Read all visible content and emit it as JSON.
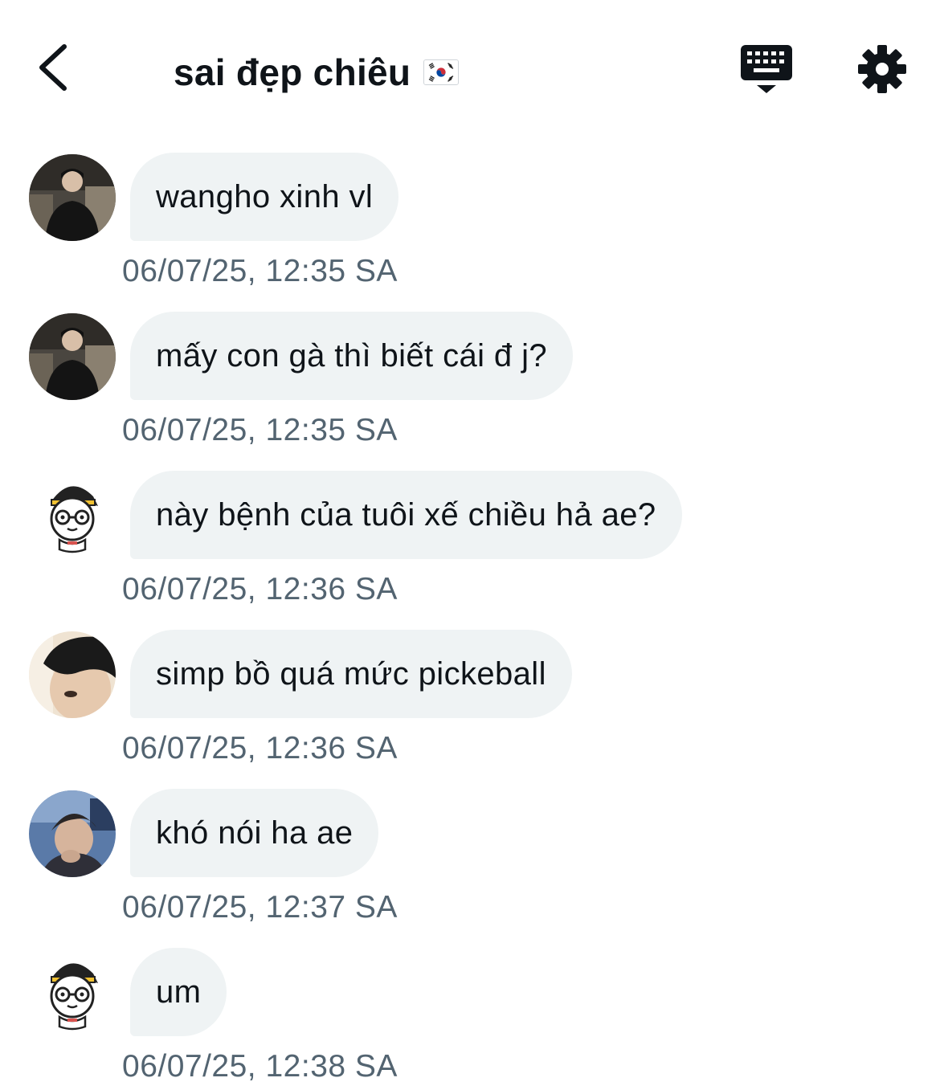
{
  "header": {
    "title": "sai đẹp chiêu",
    "back_icon": "chevron-left-icon",
    "flag_icon": "south-korea-flag-icon",
    "keyboard_icon": "keyboard-shortcuts-icon",
    "settings_icon": "gear-icon"
  },
  "colors": {
    "bubble": "#eff3f4",
    "timestamp": "#536471",
    "text": "#0f1419"
  },
  "messages": [
    {
      "text": "wangho xinh vl",
      "timestamp": "06/07/25, 12:35 SA",
      "avatar": "photo-avatar-dark"
    },
    {
      "text": "mấy con gà thì biết cái đ j?",
      "timestamp": "06/07/25, 12:35 SA",
      "avatar": "photo-avatar-dark"
    },
    {
      "text": "này bệnh của tuôi xế chiều hả ae?",
      "timestamp": "06/07/25, 12:36 SA",
      "avatar": "cartoon-avatar"
    },
    {
      "text": "simp bồ quá mức pickeball",
      "timestamp": "06/07/25, 12:36 SA",
      "avatar": "photo-avatar-face"
    },
    {
      "text": "khó nói ha ae",
      "timestamp": "06/07/25, 12:37 SA",
      "avatar": "photo-avatar-blue"
    },
    {
      "text": "um",
      "timestamp": "06/07/25, 12:38 SA",
      "avatar": "cartoon-avatar"
    }
  ]
}
